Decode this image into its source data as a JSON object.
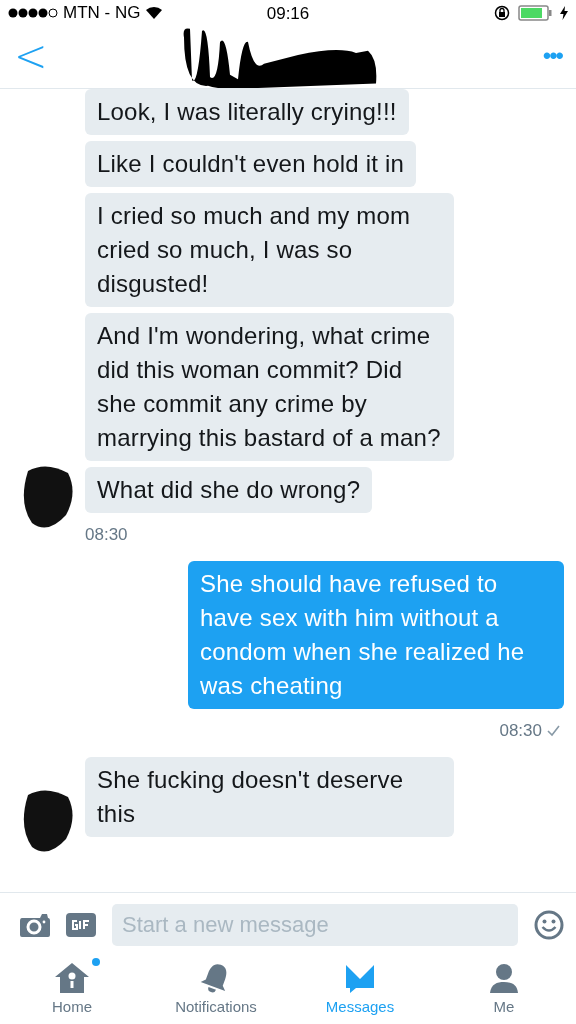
{
  "status_bar": {
    "carrier": "MTN - NG",
    "time": "09:16"
  },
  "header": {
    "back": "<",
    "more": "•••"
  },
  "messages": [
    {
      "kind": "incoming",
      "text": "Look, I was literally crying!!!",
      "avatar": false
    },
    {
      "kind": "incoming",
      "text": "Like I couldn't even hold it in",
      "avatar": false
    },
    {
      "kind": "incoming",
      "text": "I cried so much and my mom cried so much, I was so disgusted!",
      "avatar": false
    },
    {
      "kind": "incoming",
      "text": "And I'm wondering, what crime did this woman commit? Did she commit any crime by marrying this bastard of a man?",
      "avatar": false
    },
    {
      "kind": "incoming",
      "text": "What did she do wrong?",
      "avatar": true,
      "time": "08:30"
    },
    {
      "kind": "outgoing",
      "text": "She should have refused to have sex with him without a condom when she realized he was cheating",
      "time": "08:30",
      "read": true
    },
    {
      "kind": "incoming",
      "text": "She fucking doesn't deserve this",
      "avatar": true
    }
  ],
  "composer": {
    "placeholder": "Start a new message"
  },
  "tabs": [
    {
      "label": "Home",
      "selected": false,
      "dot": true
    },
    {
      "label": "Notifications",
      "selected": false,
      "dot": false
    },
    {
      "label": "Messages",
      "selected": true,
      "dot": false
    },
    {
      "label": "Me",
      "selected": false,
      "dot": false
    }
  ]
}
